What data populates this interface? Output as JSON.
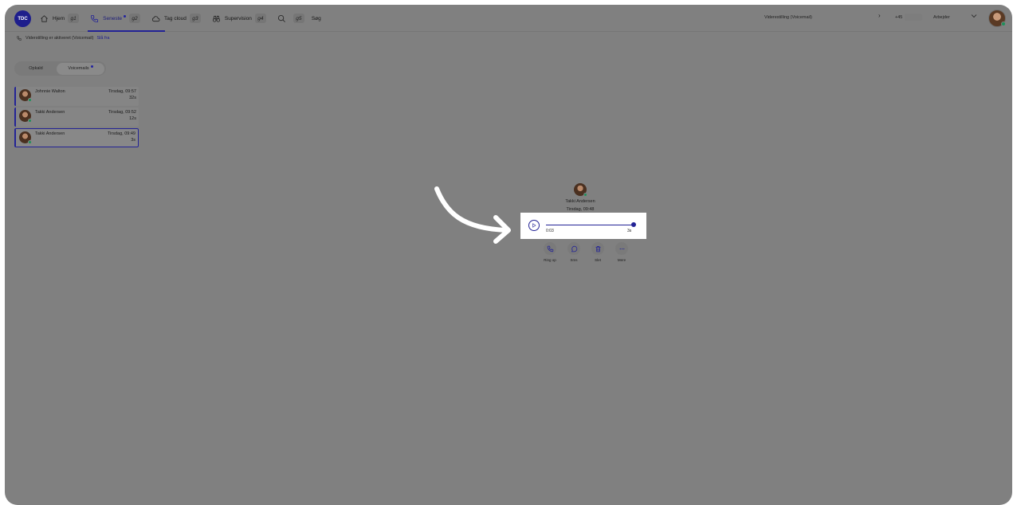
{
  "header": {
    "logo_text": "TDC",
    "nav": [
      {
        "label": "Hjem",
        "key": "g1",
        "icon": "home-icon"
      },
      {
        "label": "Seneste",
        "key": "g2",
        "icon": "phone-icon",
        "active": true
      },
      {
        "label": "Tag cloud",
        "key": "g3",
        "icon": "cloud-icon"
      },
      {
        "label": "Supervision",
        "key": "g4",
        "icon": "binoculars-icon"
      },
      {
        "label": "Søg",
        "key": "g5",
        "icon": "search-icon"
      }
    ],
    "forwarding": "Viderestilling (Voicemail)",
    "phone_prefix": "+45",
    "status": "Arbejder"
  },
  "notice": {
    "text": "Viderstilling er aktiveret (Voicemail)",
    "link": "Slå fra"
  },
  "tabs": {
    "calls": "Opkald",
    "voicemails": "Voicemails"
  },
  "voicemails": [
    {
      "name": "Johnnie Walton",
      "when": "Tirsdag, 09:57",
      "duration": "32s"
    },
    {
      "name": "Takki Andersen",
      "when": "Tirsdag, 09:52",
      "duration": "12s"
    },
    {
      "name": "Takki Andersen",
      "when": "Tirsdag, 09:49",
      "duration": "3s",
      "selected": true
    }
  ],
  "detail": {
    "name": "Takki Andersen",
    "when": "Tirsdag, 09:48",
    "player": {
      "current": "0:03",
      "total": "3s",
      "progress": 1.0
    },
    "actions": [
      {
        "label": "Ring op",
        "icon": "phone-icon"
      },
      {
        "label": "Sms",
        "icon": "chat-icon"
      },
      {
        "label": "Slet",
        "icon": "trash-icon"
      },
      {
        "label": "Mere",
        "icon": "more-icon"
      }
    ]
  },
  "colors": {
    "accent": "#232396",
    "presence": "#1f8f5a",
    "overlay": "#808080"
  }
}
